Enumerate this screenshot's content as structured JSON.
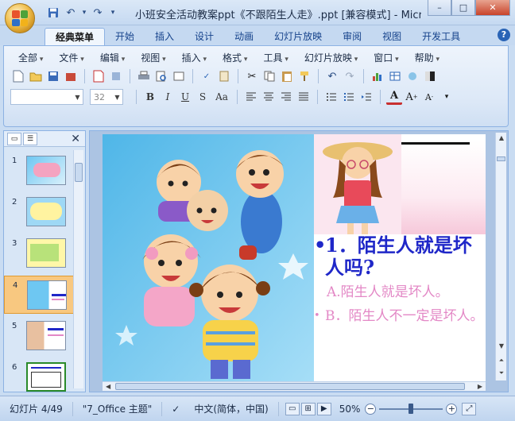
{
  "window": {
    "title": "小班安全活动教案ppt《不跟陌生人走》.ppt [兼容模式] - Micr...",
    "buttons": {
      "minimize": "–",
      "maximize": "□",
      "close": "✕"
    }
  },
  "quick_access": [
    {
      "icon": "save-icon",
      "glyph": "💾"
    },
    {
      "icon": "undo-icon",
      "glyph": "↶"
    },
    {
      "icon": "undo-dropdown-icon",
      "glyph": "▾"
    },
    {
      "icon": "redo-icon",
      "glyph": "↷"
    },
    {
      "icon": "customize-icon",
      "glyph": "▾"
    }
  ],
  "ribbon_tabs": [
    "经典菜单",
    "开始",
    "插入",
    "设计",
    "动画",
    "幻灯片放映",
    "审阅",
    "视图",
    "开发工具"
  ],
  "ribbon_tab_active": "经典菜单",
  "menus": [
    "全部",
    "文件",
    "编辑",
    "视图",
    "插入",
    "格式",
    "工具",
    "幻灯片放映",
    "窗口",
    "帮助"
  ],
  "font": {
    "name_value": "",
    "size_value": "32"
  },
  "format_buttons": [
    "B",
    "I",
    "U",
    "S",
    "Aa"
  ],
  "slide_thumbnails": [
    {
      "num": "1"
    },
    {
      "num": "2"
    },
    {
      "num": "3"
    },
    {
      "num": "4"
    },
    {
      "num": "5"
    },
    {
      "num": "6"
    }
  ],
  "selected_slide": "4",
  "slide": {
    "bullet": "•",
    "question": "1．陌生人就是坏人吗?",
    "option_a": "A.陌生人就是坏人。",
    "option_b_bullet": "•",
    "option_b": "B．陌生人不一定是坏人。"
  },
  "status": {
    "slide_info": "幻灯片 4/49",
    "theme": "\"7_Office 主题\"",
    "language": "中文(简体，中国)",
    "zoom": "50%",
    "zoom_value": 0.5
  },
  "colors": {
    "accent": "#15428b",
    "question": "#1f27c8",
    "option": "#e388c6",
    "selected_thumb": "#f8c880"
  }
}
